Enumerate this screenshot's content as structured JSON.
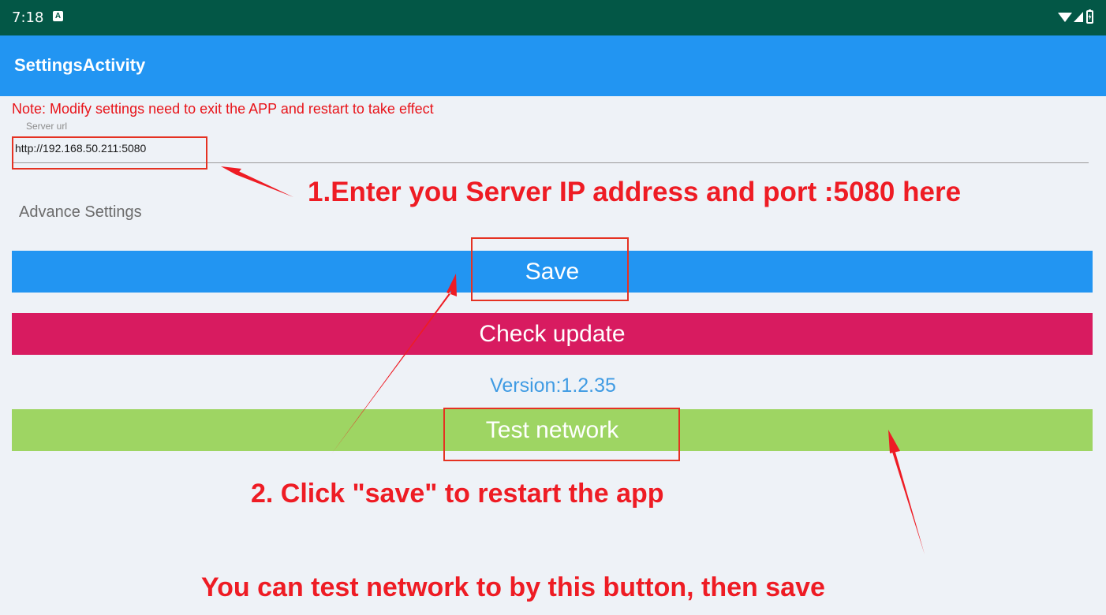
{
  "status_bar": {
    "time": "7:18",
    "notification_icon": "a-badge-icon",
    "icons": [
      "wifi-icon",
      "signal-icon",
      "battery-icon"
    ]
  },
  "app_bar": {
    "title": "SettingsActivity"
  },
  "note": "Note: Modify settings need to exit the APP and restart to take effect",
  "server_url": {
    "label": "Server url",
    "value": "http://192.168.50.211:5080"
  },
  "advance_settings_label": "Advance Settings",
  "buttons": {
    "save": "Save",
    "check_update": "Check update",
    "test_network": "Test network"
  },
  "version": "Version:1.2.35",
  "annotations": {
    "step1": "1.Enter you Server IP address and port :5080 here",
    "step2": "2. Click \"save\" to restart the app",
    "step3": "You can test network to by this button, then save"
  },
  "colors": {
    "status_bar": "#035746",
    "app_bar": "#2295f2",
    "save_button": "#2295f2",
    "check_update_button": "#d81b60",
    "test_network_button": "#9ed563",
    "annotation_red": "#ee1c24"
  }
}
